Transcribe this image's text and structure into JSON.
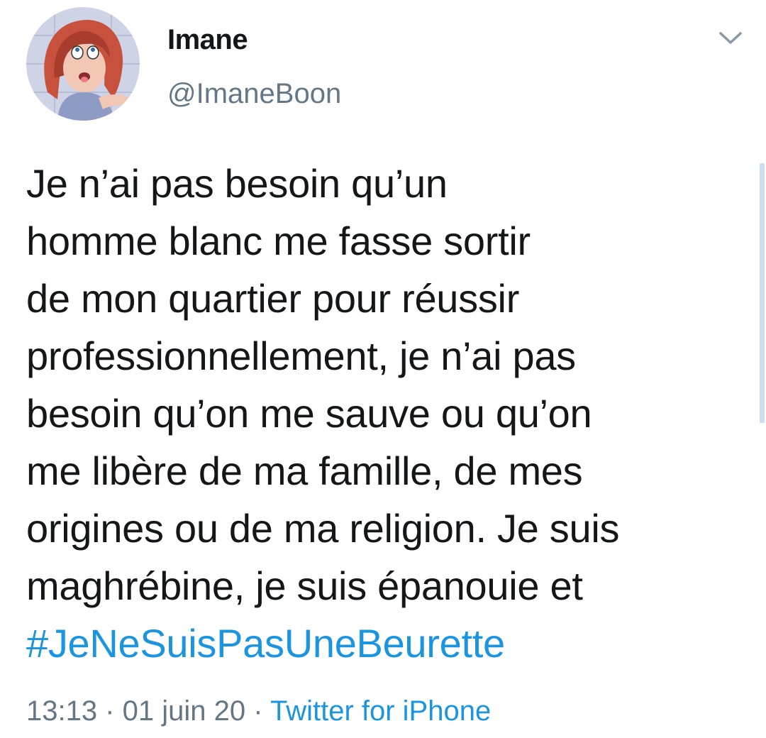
{
  "user": {
    "display_name": "Imane",
    "handle": "@ImaneBoon",
    "avatar_icon": "cartoon-avatar"
  },
  "menu": {
    "icon": "chevron-down-icon"
  },
  "tweet": {
    "lines": [
      "Je n’ai pas besoin qu’un",
      "homme blanc me fasse sortir",
      "de mon quartier pour réussir",
      "professionnellement, je n’ai pas",
      "besoin qu’on me sauve ou qu’on",
      "me libère de ma famille, de mes",
      "origines ou de ma religion. Je suis",
      "maghrébine, je suis épanouie et"
    ],
    "hashtag": "#JeNeSuisPasUneBeurette"
  },
  "meta": {
    "time": "13:13",
    "separator1": " · ",
    "date": "01 juin 20",
    "separator2": " · ",
    "source": "Twitter for iPhone"
  },
  "colors": {
    "text": "#14171a",
    "secondary": "#657786",
    "link": "#1b95e0",
    "background": "#ffffff"
  }
}
